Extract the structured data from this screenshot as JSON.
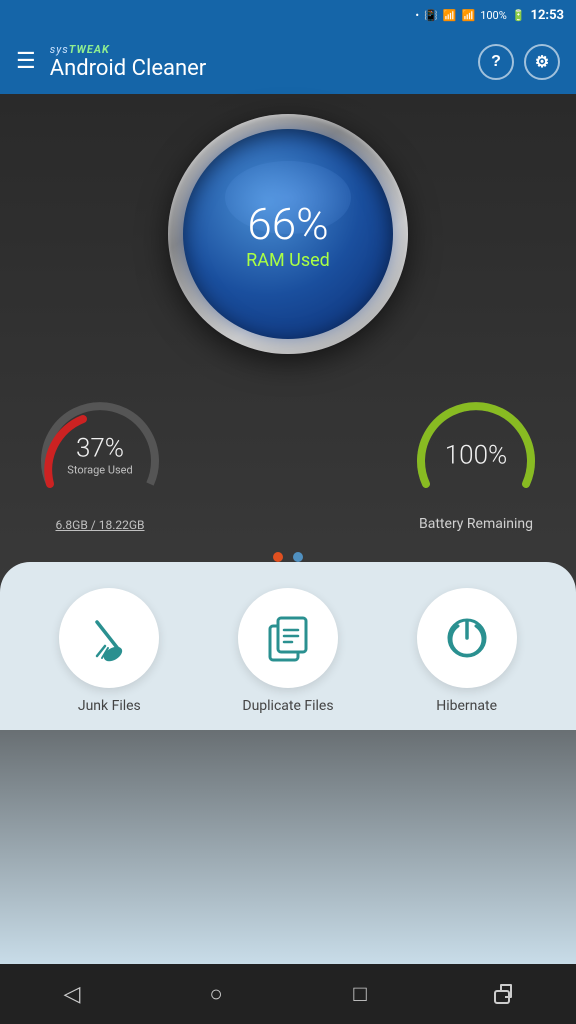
{
  "statusBar": {
    "time": "12:53",
    "battery": "100%"
  },
  "header": {
    "brandSys": "sys",
    "brandTweak": "TWEAK",
    "title": "Android Cleaner",
    "helpLabel": "?",
    "settingsLabel": "⚙"
  },
  "ramGauge": {
    "percent": "66%",
    "label": "RAM Used"
  },
  "storageGauge": {
    "percent": "37%",
    "subLabel": "Storage Used",
    "detail": "6.8GB / 18.22GB"
  },
  "batteryGauge": {
    "percent": "100%",
    "label": "Battery Remaining"
  },
  "actions": [
    {
      "id": "junk-files",
      "label": "Junk Files",
      "icon": "🧹"
    },
    {
      "id": "duplicate-files",
      "label": "Duplicate Files",
      "icon": "📋"
    },
    {
      "id": "hibernate",
      "label": "Hibernate",
      "icon": "⏻"
    }
  ],
  "navBar": {
    "back": "◁",
    "home": "○",
    "recents": "□",
    "share": "↗"
  }
}
